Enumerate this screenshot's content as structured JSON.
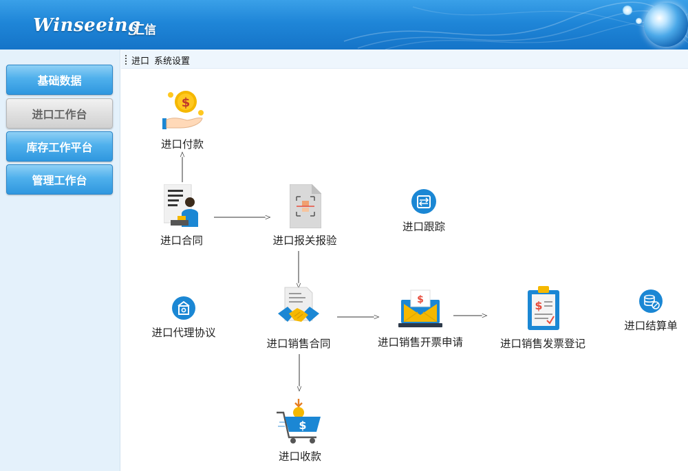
{
  "header": {
    "logo_text": "Winseeing",
    "logo_cn": "汇信"
  },
  "sidebar": {
    "items": [
      {
        "label": "基础数据",
        "active": false
      },
      {
        "label": "进口工作台",
        "active": true
      },
      {
        "label": "库存工作平台",
        "active": false
      },
      {
        "label": "管理工作台",
        "active": false
      }
    ]
  },
  "breadcrumb": {
    "items": [
      "进口",
      "系统设置"
    ]
  },
  "workflow": {
    "payment": "进口付款",
    "contract": "进口合同",
    "customs": "进口报关报验",
    "tracking": "进口跟踪",
    "agency": "进口代理协议",
    "sales_contract": "进口销售合同",
    "invoice_request": "进口销售开票申请",
    "invoice_register": "进口销售发票登记",
    "settlement": "进口结算单",
    "receipt": "进口收款"
  },
  "colors": {
    "accent": "#1f86d8",
    "icon_blue": "#1b87d4",
    "coin_gold": "#f5b800",
    "sidebar_bg": "#e4f1fb"
  }
}
